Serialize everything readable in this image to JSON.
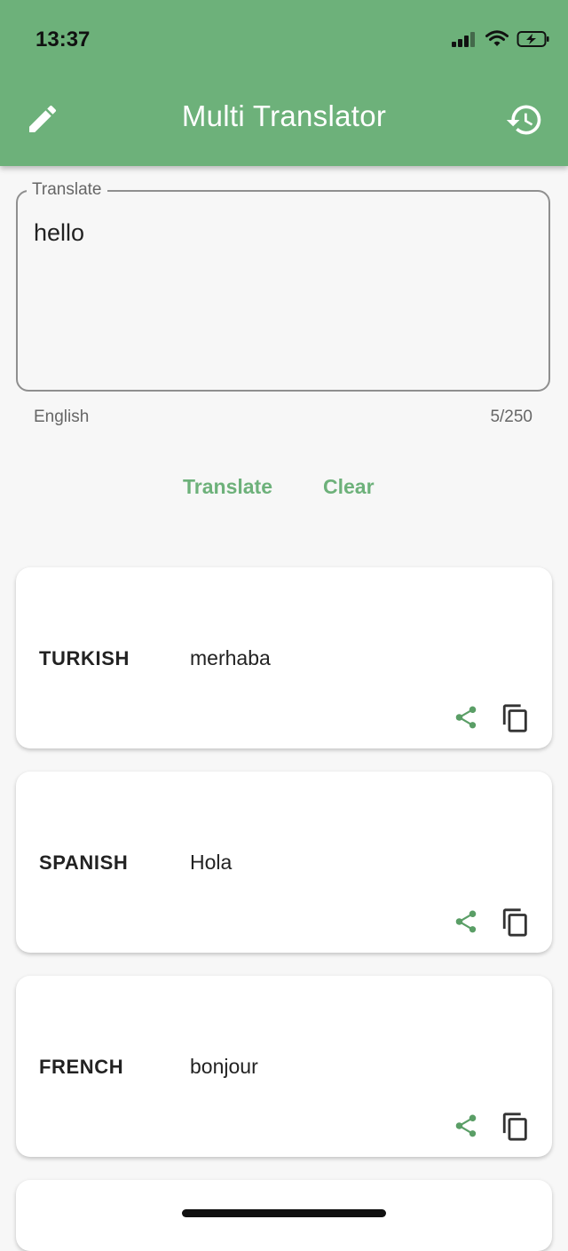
{
  "status_bar": {
    "time": "13:37"
  },
  "app_bar": {
    "title": "Multi Translator",
    "edit_icon": "pencil-icon",
    "history_icon": "history-icon"
  },
  "input": {
    "label": "Translate",
    "value": "hello",
    "language": "English",
    "counter": "5/250"
  },
  "actions": {
    "translate_label": "Translate",
    "clear_label": "Clear"
  },
  "results": [
    {
      "language": "TURKISH",
      "text": "merhaba"
    },
    {
      "language": "SPANISH",
      "text": "Hola"
    },
    {
      "language": "FRENCH",
      "text": "bonjour"
    }
  ],
  "colors": {
    "primary": "#6db17a",
    "accent_icon": "#5a9e66"
  }
}
